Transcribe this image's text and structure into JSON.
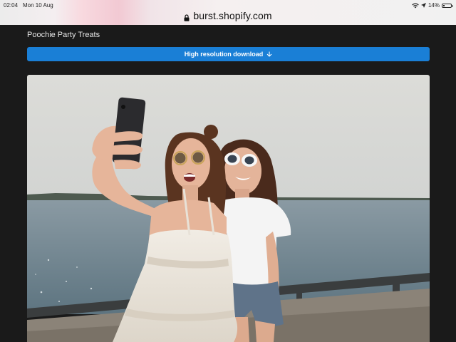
{
  "status_bar": {
    "time": "02:04",
    "date": "Mon 10 Aug",
    "battery_percent": "14%",
    "battery_level": 0.14
  },
  "browser": {
    "url": "burst.shopify.com"
  },
  "page": {
    "title": "Poochie Party Treats",
    "download_label": "High resolution download",
    "accent_color": "#1a7fd6"
  }
}
